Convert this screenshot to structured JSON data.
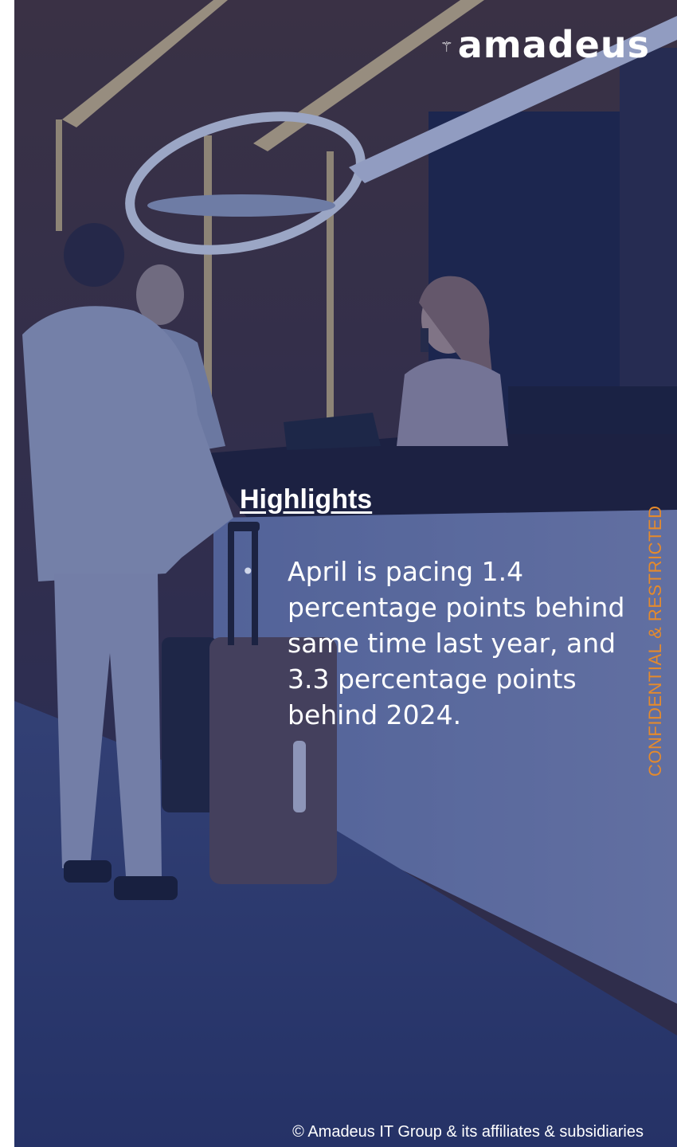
{
  "brand": {
    "logo_text": "amadeus",
    "logo_mark": "⚚"
  },
  "highlights": {
    "title": "Highlights",
    "bullets": [
      {
        "text": "April is pacing 1.4 percentage points behind same time last year, and 3.3 percentage points behind 2024."
      }
    ]
  },
  "classification_label": "CONFIDENTIAL & RESTRICTED",
  "footer": {
    "copyright": "© Amadeus IT Group & its affiliates & subsidiaries"
  },
  "colors": {
    "overlay": "#1c2d6e",
    "text": "#ffffff",
    "classification": "#e58a2c"
  }
}
